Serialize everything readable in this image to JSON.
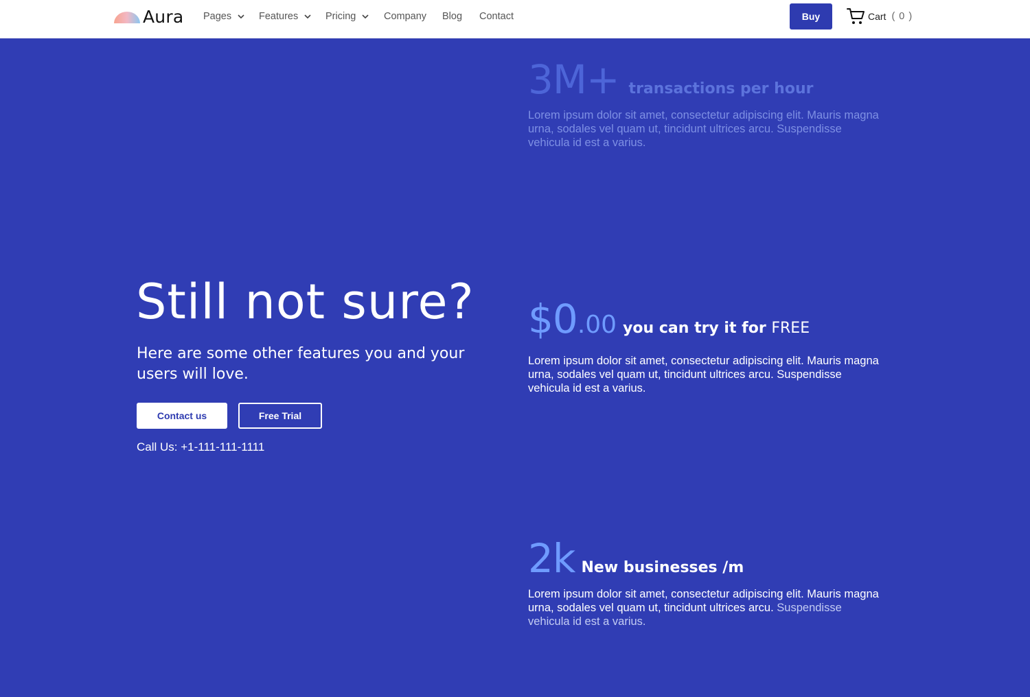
{
  "navbar": {
    "brand": "Aura",
    "links": [
      {
        "label": "Pages",
        "has_dropdown": true
      },
      {
        "label": "Features",
        "has_dropdown": true
      },
      {
        "label": "Pricing",
        "has_dropdown": true
      },
      {
        "label": "Company",
        "has_dropdown": false
      },
      {
        "label": "Blog",
        "has_dropdown": false
      },
      {
        "label": "Contact",
        "has_dropdown": false
      }
    ],
    "buy_label": "Buy",
    "cart_label": "Cart",
    "cart_count": "( 0 )"
  },
  "hero": {
    "title": "Still not sure?",
    "subtitle": "Here are some other features you and your users will love.",
    "contact_label": "Contact us",
    "trial_label": "Free Trial",
    "call_us": "Call Us: +1-111-111-1111"
  },
  "stats": [
    {
      "value": "3M+",
      "caption": "transactions per hour",
      "body": "Lorem ipsum dolor sit amet, consectetur adipiscing elit. Mauris magna urna, sodales vel quam ut, tincidunt ultrices arcu. Suspendisse vehicula id est a varius."
    },
    {
      "value": "$0",
      "cents": ".00",
      "caption": "you can try it for",
      "caption_tail": "FREE",
      "body": "Lorem ipsum dolor sit amet, consectetur adipiscing elit. Mauris magna urna, sodales vel quam ut, tincidunt ultrices arcu. Suspendisse vehicula id est a varius."
    },
    {
      "value": "2k",
      "caption": "New businesses /m",
      "body_main": "Lorem ipsum dolor sit amet, consectetur adipiscing elit. Mauris magna urna, sodales vel quam ut, tincidunt ultrices arcu.",
      "body_tail": "Suspendisse vehicula id est a varius."
    }
  ],
  "colors": {
    "background": "#303db4",
    "primary": "#2e3bb0",
    "accent": "#6f9bff",
    "navbar": "#ffffff"
  },
  "icons": [
    "aura-logo-icon",
    "chevron-down-icon",
    "cart-icon"
  ]
}
